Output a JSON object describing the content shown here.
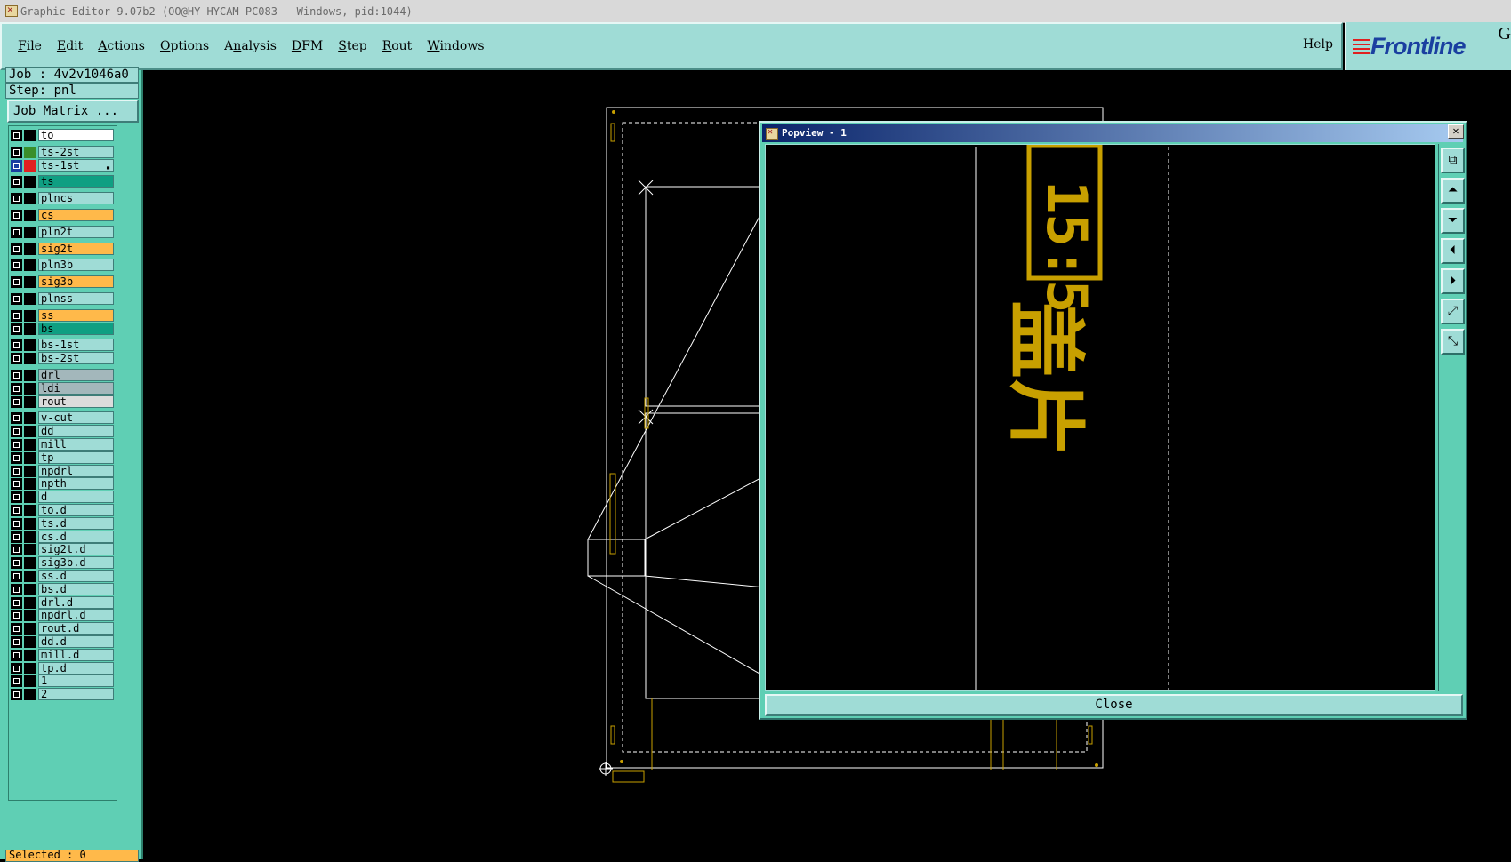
{
  "window": {
    "title": "Graphic Editor 9.07b2 (OO@HY-HYCAM-PC083 - Windows, pid:1044)"
  },
  "menu": {
    "items": [
      {
        "label": "File",
        "underline": "F"
      },
      {
        "label": "Edit",
        "underline": "E"
      },
      {
        "label": "Actions",
        "underline": "A"
      },
      {
        "label": "Options",
        "underline": "O"
      },
      {
        "label": "Analysis",
        "underline": "n"
      },
      {
        "label": "DFM",
        "underline": "D"
      },
      {
        "label": "Step",
        "underline": "S"
      },
      {
        "label": "Rout",
        "underline": "R"
      },
      {
        "label": "Windows",
        "underline": "W"
      }
    ],
    "help": "Help"
  },
  "logo": {
    "text": "Frontline",
    "suffix": "G"
  },
  "job": {
    "label": "Job : 4v2v1046a0",
    "step": "Step: pnl",
    "matrix_button": "Job Matrix ..."
  },
  "layers": [
    {
      "name": "to",
      "color": "#ffffff",
      "swatch": "#000000"
    },
    {
      "name": "ts-2st",
      "color": "#9fdcd6",
      "swatch": "#3a8f2a"
    },
    {
      "name": "ts-1st",
      "color": "#9fdcd6",
      "swatch": "#e02020",
      "selected": true,
      "mark": "▪"
    },
    {
      "name": "ts",
      "color": "#0f9f82",
      "swatch": "#000000"
    },
    {
      "name": "plncs",
      "color": "#9fdcd6",
      "swatch": "#000000"
    },
    {
      "name": "cs",
      "color": "#ffb94a",
      "swatch": "#000000"
    },
    {
      "name": "pln2t",
      "color": "#9fdcd6",
      "swatch": "#000000"
    },
    {
      "name": "sig2t",
      "color": "#ffb94a",
      "swatch": "#000000"
    },
    {
      "name": "pln3b",
      "color": "#9fdcd6",
      "swatch": "#000000"
    },
    {
      "name": "sig3b",
      "color": "#ffb94a",
      "swatch": "#000000"
    },
    {
      "name": "plnss",
      "color": "#9fdcd6",
      "swatch": "#000000"
    },
    {
      "name": "ss",
      "color": "#ffb94a",
      "swatch": "#000000"
    },
    {
      "name": "bs",
      "color": "#0f9f82",
      "swatch": "#000000"
    },
    {
      "name": "bs-1st",
      "color": "#9fdcd6",
      "swatch": "#000000"
    },
    {
      "name": "bs-2st",
      "color": "#9fdcd6",
      "swatch": "#000000"
    },
    {
      "name": "drl",
      "color": "#a3b7bb",
      "swatch": "#000000"
    },
    {
      "name": "ldi",
      "color": "#a3b7bb",
      "swatch": "#000000"
    },
    {
      "name": "rout",
      "color": "#dcdcdc",
      "swatch": "#000000"
    },
    {
      "name": "v-cut",
      "color": "#9fdcd6",
      "swatch": "#000000"
    },
    {
      "name": "dd",
      "color": "#9fdcd6",
      "swatch": "#000000"
    },
    {
      "name": "mill",
      "color": "#9fdcd6",
      "swatch": "#000000"
    },
    {
      "name": "tp",
      "color": "#9fdcd6",
      "swatch": "#000000"
    },
    {
      "name": "npdrl",
      "color": "#9fdcd6",
      "swatch": "#000000"
    },
    {
      "name": "npth",
      "color": "#9fdcd6",
      "swatch": "#000000"
    },
    {
      "name": "d",
      "color": "#9fdcd6",
      "swatch": "#000000"
    },
    {
      "name": "to.d",
      "color": "#9fdcd6",
      "swatch": "#000000"
    },
    {
      "name": "ts.d",
      "color": "#9fdcd6",
      "swatch": "#000000"
    },
    {
      "name": "cs.d",
      "color": "#9fdcd6",
      "swatch": "#000000"
    },
    {
      "name": "sig2t.d",
      "color": "#9fdcd6",
      "swatch": "#000000"
    },
    {
      "name": "sig3b.d",
      "color": "#9fdcd6",
      "swatch": "#000000"
    },
    {
      "name": "ss.d",
      "color": "#9fdcd6",
      "swatch": "#000000"
    },
    {
      "name": "bs.d",
      "color": "#9fdcd6",
      "swatch": "#000000"
    },
    {
      "name": "drl.d",
      "color": "#9fdcd6",
      "swatch": "#000000"
    },
    {
      "name": "npdrl.d",
      "color": "#9fdcd6",
      "swatch": "#000000"
    },
    {
      "name": "rout.d",
      "color": "#9fdcd6",
      "swatch": "#000000"
    },
    {
      "name": "dd.d",
      "color": "#9fdcd6",
      "swatch": "#000000"
    },
    {
      "name": "mill.d",
      "color": "#9fdcd6",
      "swatch": "#000000"
    },
    {
      "name": "tp.d",
      "color": "#9fdcd6",
      "swatch": "#000000"
    },
    {
      "name": "1",
      "color": "#9fdcd6",
      "swatch": "#000000"
    },
    {
      "name": "2",
      "color": "#9fdcd6",
      "swatch": "#000000"
    }
  ],
  "status": {
    "selected": "Selected : 0"
  },
  "popview": {
    "title": "Popview - 1",
    "close_x": "✕",
    "close_button": "Close",
    "zoom_text": "15:5",
    "chinese_text": "盖片",
    "toolbar_icons": [
      "zoom-fit-icon",
      "pan-up-icon",
      "pan-down-icon",
      "pan-left-icon",
      "pan-right-icon",
      "zoom-in-icon",
      "zoom-out-icon"
    ]
  },
  "colors": {
    "accent": "#9fdcd6",
    "panel": "#5fcfb4",
    "feature": "#c8a000",
    "outline": "#ffffff"
  }
}
